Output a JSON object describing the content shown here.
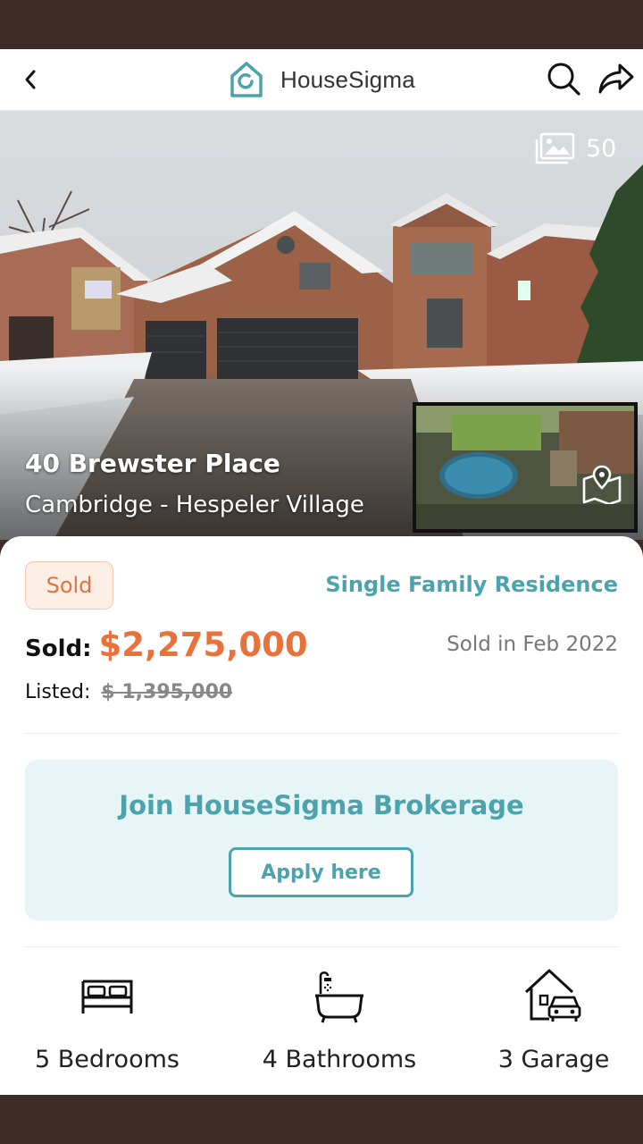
{
  "header": {
    "app_name": "HouseSigma",
    "brand_color": "#4aa3ad"
  },
  "hero": {
    "photo_count": "50",
    "address": "40 Brewster Place",
    "neighborhood": "Cambridge - Hespeler Village"
  },
  "listing": {
    "status_badge": "Sold",
    "property_type": "Single Family Residence",
    "sold_label": "Sold:",
    "sold_price": "$2,275,000",
    "sold_date": "Sold in Feb 2022",
    "listed_label": "Listed:",
    "listed_price": "$ 1,395,000",
    "accent_color": "#e9713a"
  },
  "promo": {
    "title": "Join HouseSigma Brokerage",
    "button_label": "Apply here"
  },
  "features": [
    {
      "icon": "bed-icon",
      "label": "5 Bedrooms"
    },
    {
      "icon": "bathtub-icon",
      "label": "4 Bathrooms"
    },
    {
      "icon": "garage-icon",
      "label": "3 Garage"
    }
  ]
}
